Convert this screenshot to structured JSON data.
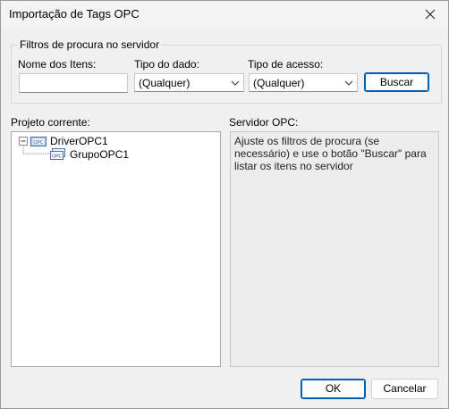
{
  "window": {
    "title": "Importação de Tags OPC"
  },
  "filters": {
    "group_title": "Filtros de procura no servidor",
    "item_names_label": "Nome dos Itens:",
    "item_names_value": "",
    "data_type_label": "Tipo do dado:",
    "data_type_value": "(Qualquer)",
    "access_type_label": "Tipo de acesso:",
    "access_type_value": "(Qualquer)",
    "search_button": "Buscar"
  },
  "current_project": {
    "label": "Projeto corrente:",
    "tree": [
      {
        "label": "DriverOPC1",
        "expanded": true,
        "icon": "opc-driver-icon"
      },
      {
        "label": "GrupoOPC1",
        "icon": "opc-group-icon"
      }
    ]
  },
  "opc_server": {
    "label": "Servidor OPC:",
    "message": "Ajuste os filtros de procura (se necessário) e use o botão \"Buscar\" para listar os itens no servidor"
  },
  "footer": {
    "ok_label": "OK",
    "cancel_label": "Cancelar"
  }
}
